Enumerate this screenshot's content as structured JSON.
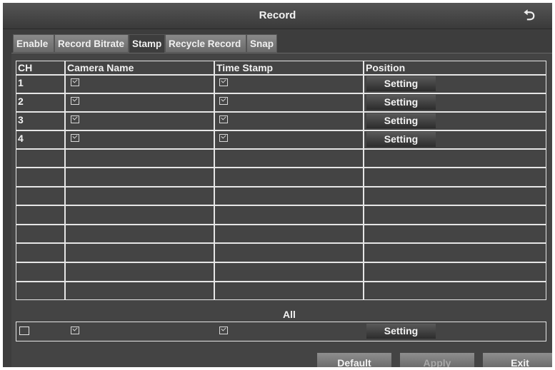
{
  "window": {
    "title": "Record"
  },
  "tabs": [
    {
      "label": "Enable"
    },
    {
      "label": "Record Bitrate"
    },
    {
      "label": "Stamp",
      "active": true
    },
    {
      "label": "Recycle Record"
    },
    {
      "label": "Snap"
    }
  ],
  "table": {
    "headers": [
      "CH",
      "Camera Name",
      "Time Stamp",
      "Position"
    ],
    "rows": [
      {
        "ch": "1",
        "camera_name": true,
        "time_stamp": true,
        "position": "Setting"
      },
      {
        "ch": "2",
        "camera_name": true,
        "time_stamp": true,
        "position": "Setting"
      },
      {
        "ch": "3",
        "camera_name": true,
        "time_stamp": true,
        "position": "Setting"
      },
      {
        "ch": "4",
        "camera_name": true,
        "time_stamp": true,
        "position": "Setting"
      }
    ]
  },
  "all": {
    "label": "All",
    "select_all": false,
    "camera_name": true,
    "time_stamp": true,
    "position": "Setting"
  },
  "footer": {
    "default_label": "Default",
    "apply_label": "Apply",
    "exit_label": "Exit"
  },
  "icons": {
    "back": "return-arrow-icon",
    "checkbox": "checkbox-checked-icon"
  }
}
